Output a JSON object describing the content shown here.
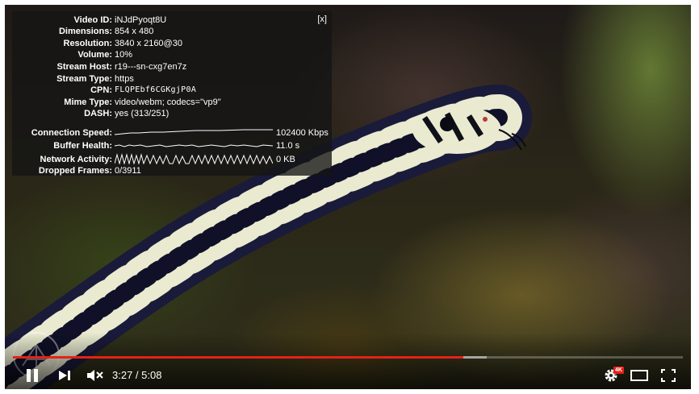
{
  "stats_panel": {
    "close_label": "[x]",
    "rows": [
      {
        "label": "Video ID:",
        "value": "iNJdPyoqt8U"
      },
      {
        "label": "Dimensions:",
        "value": "854 x 480"
      },
      {
        "label": "Resolution:",
        "value": "3840 x 2160@30"
      },
      {
        "label": "Volume:",
        "value": "10%"
      },
      {
        "label": "Stream Host:",
        "value": "r19---sn-cxg7en7z"
      },
      {
        "label": "Stream Type:",
        "value": "https"
      },
      {
        "label": "CPN:",
        "value": "FLQPEbf6CGKgjP0A"
      },
      {
        "label": "Mime Type:",
        "value": "video/webm; codecs=\"vp9\""
      },
      {
        "label": "DASH:",
        "value": "yes (313/251)"
      }
    ],
    "graphs": [
      {
        "label": "Connection Speed:",
        "value": "102400 Kbps"
      },
      {
        "label": "Buffer Health:",
        "value": "11.0 s"
      },
      {
        "label": "Network Activity:",
        "value": "0 KB"
      }
    ],
    "dropped_frames": {
      "label": "Dropped Frames:",
      "value": "0/3911"
    }
  },
  "player": {
    "current_time": "3:27",
    "duration": "5:08",
    "time_separator": " / ",
    "played_fraction": 0.672,
    "buffered_fraction": 0.707,
    "quality_badge": "4K",
    "progress_color": "#e52117",
    "icons": [
      "pause-icon",
      "next-icon",
      "volume-muted-icon",
      "settings-gear-icon",
      "theater-mode-icon",
      "fullscreen-icon"
    ]
  }
}
